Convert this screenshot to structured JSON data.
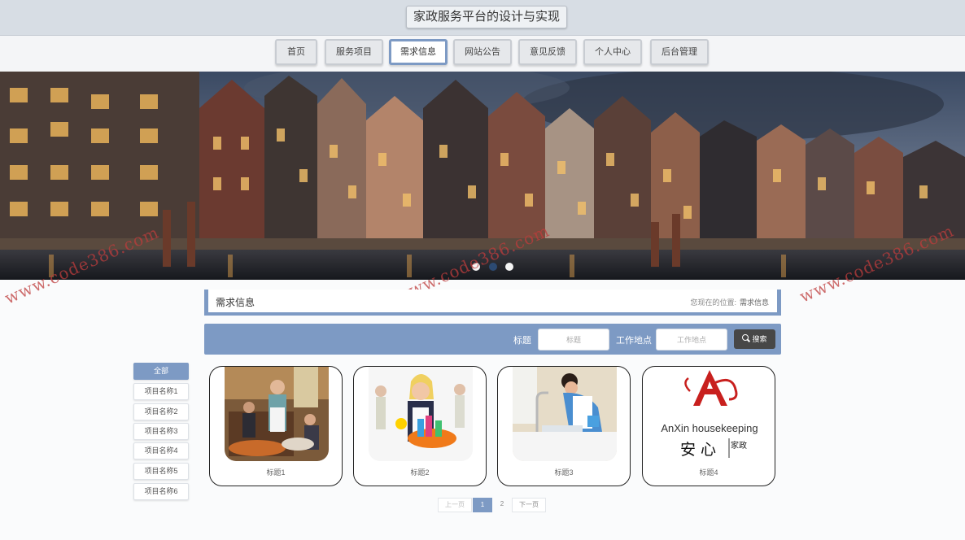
{
  "site": {
    "title": "家政服务平台的设计与实现"
  },
  "nav": {
    "items": [
      {
        "label": "首页"
      },
      {
        "label": "服务项目"
      },
      {
        "label": "需求信息"
      },
      {
        "label": "网站公告"
      },
      {
        "label": "意见反馈"
      },
      {
        "label": "个人中心"
      },
      {
        "label": "后台管理"
      }
    ],
    "active_index": 2
  },
  "banner": {
    "slide_count": 3,
    "active_slide": 2
  },
  "watermark": {
    "text": "www.code386.com"
  },
  "section": {
    "title": "需求信息",
    "breadcrumb_label": "您现在的位置:",
    "breadcrumb_current": "需求信息"
  },
  "search": {
    "title_label": "标题",
    "title_placeholder": "标题",
    "location_label": "工作地点",
    "location_placeholder": "工作地点",
    "button_label": "搜索"
  },
  "sidebar": {
    "items": [
      {
        "label": "全部"
      },
      {
        "label": "项目名称1"
      },
      {
        "label": "项目名称2"
      },
      {
        "label": "项目名称3"
      },
      {
        "label": "项目名称4"
      },
      {
        "label": "项目名称5"
      },
      {
        "label": "项目名称6"
      }
    ],
    "active_index": 0
  },
  "cards": [
    {
      "name": "标题1",
      "image": "waitress-serving-table"
    },
    {
      "name": "标题2",
      "image": "cleaner-with-supplies"
    },
    {
      "name": "标题3",
      "image": "woman-cleaning-sink"
    },
    {
      "name": "标题4",
      "image": "anxin-housekeeping-logo",
      "logo_text_en": "AnXin housekeeping",
      "logo_text_cn": "安 心",
      "logo_side": "家政"
    }
  ],
  "pagination": {
    "prev": "上一页",
    "pages": [
      "1",
      "2"
    ],
    "current": "1",
    "next": "下一页"
  },
  "colors": {
    "accent": "#7d9ac4",
    "search_button": "#474747",
    "watermark": "#be3c3c"
  }
}
